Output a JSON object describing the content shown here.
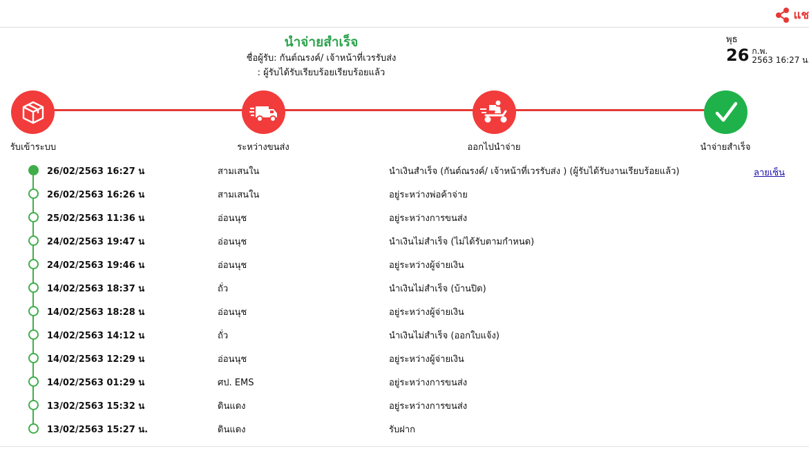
{
  "header": {
    "share_label": "แช",
    "colors": {
      "accent_red": "#e53935",
      "success_green": "#2da44e"
    }
  },
  "status": {
    "title": "นำจ่ายสำเร็จ",
    "receiver_line": "ชื่อผู้รับ: กันต์ณรงค์/ เจ้าหน้าที่เวรรับส่ง",
    "note_line": ": ผู้รับได้รับเรียบร้อยเรียบร้อยแล้ว"
  },
  "date": {
    "weekday": "พุธ",
    "day": "26",
    "month": "ก.พ.",
    "year_time": "2563 16:27 น."
  },
  "steps": [
    {
      "label": "รับเข้าระบบ",
      "icon": "box-icon",
      "color": "red"
    },
    {
      "label": "ระหว่างขนส่ง",
      "icon": "truck-icon",
      "color": "red"
    },
    {
      "label": "ออกไปนำจ่าย",
      "icon": "delivery-scooter-icon",
      "color": "red"
    },
    {
      "label": "นำจ่ายสำเร็จ",
      "icon": "check-icon",
      "color": "green"
    }
  ],
  "timeline": {
    "signature_link": "ลายเซ็น",
    "rows": [
      {
        "datetime": "26/02/2563 16:27 น",
        "location": "สามเสนใน",
        "status": "นำเงินสำเร็จ (กันต์ณรงค์/ เจ้าหน้าที่เวรรับส่ง ) (ผู้รับได้รับงานเรียบร้อยแล้ว)"
      },
      {
        "datetime": "26/02/2563 16:26 น",
        "location": "สามเสนใน",
        "status": "อยู่ระหว่างพ่อค้าจ่าย"
      },
      {
        "datetime": "25/02/2563 11:36 น",
        "location": "อ่อนนุช",
        "status": "อยู่ระหว่างการขนส่ง"
      },
      {
        "datetime": "24/02/2563 19:47 น",
        "location": "อ่อนนุช",
        "status": "นำเงินไม่สำเร็จ (ไม่ได้รับตามกำหนด)"
      },
      {
        "datetime": "24/02/2563 19:46 น",
        "location": "อ่อนนุช",
        "status": "อยู่ระหว่างผู้จ่ายเงิน"
      },
      {
        "datetime": "14/02/2563 18:37 น",
        "location": "ถั่ว",
        "status": "นำเงินไม่สำเร็จ (บ้านปิด)"
      },
      {
        "datetime": "14/02/2563 18:28 น",
        "location": "อ่อนนุช",
        "status": "อยู่ระหว่างผู้จ่ายเงิน"
      },
      {
        "datetime": "14/02/2563 14:12 น",
        "location": "ถั่ว",
        "status": "นำเงินไม่สำเร็จ (ออกใบแจ้ง)"
      },
      {
        "datetime": "14/02/2563 12:29 น",
        "location": "อ่อนนุช",
        "status": "อยู่ระหว่างผู้จ่ายเงิน"
      },
      {
        "datetime": "14/02/2563 01:29 น",
        "location": "ศป. EMS",
        "status": "อยู่ระหว่างการขนส่ง"
      },
      {
        "datetime": "13/02/2563 15:32 น",
        "location": "ดินแดง",
        "status": "อยู่ระหว่างการขนส่ง"
      },
      {
        "datetime": "13/02/2563 15:27 น.",
        "location": "ดินแดง",
        "status": "รับฝาก"
      }
    ]
  }
}
